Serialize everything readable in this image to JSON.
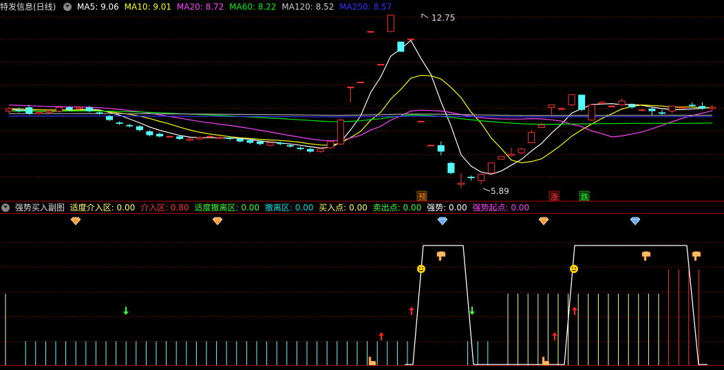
{
  "main_panel": {
    "title": "特发信息(日线)",
    "ma": [
      {
        "label": "MA5: 9.06",
        "color": "#ffffff"
      },
      {
        "label": "MA10: 9.01",
        "color": "#ffff00"
      },
      {
        "label": "MA20: 8.72",
        "color": "#ff44ff"
      },
      {
        "label": "MA60: 8.22",
        "color": "#00ee00"
      },
      {
        "label": "MA120: 8.52",
        "color": "#cccccc"
      },
      {
        "label": "MA250: 8.57",
        "color": "#3333ff"
      }
    ],
    "high_label": "12.75",
    "low_label": "5.89",
    "markers": [
      {
        "text": "预",
        "color": "#ff8800"
      },
      {
        "text": "涨",
        "color": "#ff3333"
      },
      {
        "text": "跌",
        "color": "#33ff33"
      }
    ]
  },
  "sub_panel": {
    "title": "强势买入副图",
    "indicators": [
      {
        "label": "适度介入区: 0.00",
        "color": "#ffff66"
      },
      {
        "label": "介入区: 0.80",
        "color": "#ff3333"
      },
      {
        "label": "适度撤离区: 0.00",
        "color": "#33ff33"
      },
      {
        "label": "撤离区: 0.00",
        "color": "#00dddd"
      },
      {
        "label": "买入点: 0.00",
        "color": "#ffff66"
      },
      {
        "label": "卖出点: 0.00",
        "color": "#33ff33"
      },
      {
        "label": "强势: 0.00",
        "color": "#ffffff"
      },
      {
        "label": "强势起点: 0.00",
        "color": "#ff44ff"
      }
    ]
  },
  "colors": {
    "up": "#ff3232",
    "down": "#54ffff",
    "grid": "#800000",
    "bg": "#000000"
  },
  "chart_data": {
    "type": "candlestick",
    "candles": [
      [
        8.95,
        9.05,
        8.85,
        9.1
      ],
      [
        9.0,
        8.95,
        8.9,
        9.1
      ],
      [
        9.1,
        8.85,
        8.8,
        9.2
      ],
      [
        8.85,
        8.9,
        8.8,
        8.95
      ],
      [
        8.9,
        8.95,
        8.85,
        9.0
      ],
      [
        8.95,
        9.1,
        8.9,
        9.15
      ],
      [
        9.1,
        9.0,
        8.95,
        9.15
      ],
      [
        9.05,
        9.1,
        9.0,
        9.15
      ],
      [
        9.1,
        8.95,
        8.9,
        9.15
      ],
      [
        8.9,
        8.85,
        8.8,
        8.95
      ],
      [
        8.75,
        8.6,
        8.55,
        8.8
      ],
      [
        8.5,
        8.45,
        8.4,
        8.55
      ],
      [
        8.4,
        8.35,
        8.3,
        8.45
      ],
      [
        8.35,
        8.2,
        8.15,
        8.4
      ],
      [
        8.15,
        8.0,
        7.95,
        8.2
      ],
      [
        8.05,
        7.95,
        7.9,
        8.1
      ],
      [
        7.95,
        7.95,
        7.9,
        8.0
      ],
      [
        7.95,
        7.85,
        7.8,
        8.0
      ],
      [
        7.8,
        7.85,
        7.75,
        7.9
      ],
      [
        7.85,
        7.9,
        7.8,
        7.95
      ],
      [
        7.95,
        7.95,
        7.9,
        8.0
      ],
      [
        7.9,
        7.9,
        7.85,
        7.95
      ],
      [
        7.9,
        7.85,
        7.8,
        7.95
      ],
      [
        7.85,
        7.75,
        7.7,
        7.9
      ],
      [
        7.8,
        7.7,
        7.65,
        7.85
      ],
      [
        7.75,
        7.65,
        7.6,
        7.8
      ],
      [
        7.6,
        7.7,
        7.55,
        7.75
      ],
      [
        7.7,
        7.65,
        7.6,
        7.75
      ],
      [
        7.6,
        7.55,
        7.5,
        7.65
      ],
      [
        7.5,
        7.45,
        7.4,
        7.55
      ],
      [
        7.45,
        7.35,
        7.3,
        7.5
      ],
      [
        7.35,
        7.45,
        7.3,
        7.5
      ],
      [
        7.5,
        7.75,
        7.45,
        7.8
      ],
      [
        7.65,
        8.6,
        7.6,
        8.65
      ],
      [
        9.9,
        9.9,
        9.3,
        9.9
      ],
      [
        10.1,
        10.1,
        10.1,
        10.1
      ],
      [
        12.1,
        12.1,
        12.1,
        12.1
      ],
      [
        10.8,
        10.8,
        10.8,
        10.8
      ],
      [
        12.1,
        12.75,
        12.1,
        12.75
      ],
      [
        11.7,
        11.3,
        11.7,
        11.3
      ],
      [
        11.8,
        11.8,
        11.8,
        11.8
      ],
      [
        8.55,
        8.55,
        8.55,
        8.55
      ],
      [
        7.6,
        7.6,
        7.6,
        7.6
      ],
      [
        7.6,
        7.35,
        7.2,
        7.75
      ],
      [
        6.9,
        6.5,
        6.45,
        6.95
      ],
      [
        6.05,
        6.1,
        5.89,
        6.5
      ],
      [
        6.35,
        6.3,
        6.2,
        6.4
      ],
      [
        6.2,
        6.45,
        6.05,
        6.5
      ],
      [
        6.5,
        6.9,
        6.45,
        6.9
      ],
      [
        7.05,
        7.15,
        7.05,
        7.15
      ],
      [
        7.2,
        7.25,
        7.15,
        7.5
      ],
      [
        7.3,
        7.45,
        7.25,
        7.5
      ],
      [
        7.7,
        8.1,
        7.7,
        8.2
      ],
      [
        8.3,
        8.4,
        8.3,
        8.5
      ],
      [
        9.1,
        9.2,
        8.8,
        9.2
      ],
      [
        9.05,
        9.05,
        9.0,
        9.1
      ],
      [
        9.2,
        9.6,
        9.15,
        9.6
      ],
      [
        9.6,
        9.0,
        8.95,
        9.6
      ],
      [
        8.6,
        9.2,
        8.55,
        9.25
      ],
      [
        9.25,
        9.3,
        9.2,
        9.35
      ],
      [
        9.15,
        9.15,
        9.1,
        9.2
      ],
      [
        9.2,
        9.35,
        9.15,
        9.45
      ],
      [
        9.2,
        9.1,
        9.05,
        9.25
      ],
      [
        9.0,
        9.0,
        8.95,
        9.05
      ],
      [
        9.05,
        8.95,
        8.8,
        9.1
      ],
      [
        8.9,
        8.85,
        8.8,
        9.0
      ],
      [
        8.95,
        9.15,
        8.85,
        9.15
      ],
      [
        9.1,
        9.1,
        9.05,
        9.15
      ],
      [
        9.2,
        9.15,
        9.1,
        9.3
      ],
      [
        9.15,
        9.05,
        9.0,
        9.3
      ],
      [
        9.05,
        9.1,
        9.0,
        9.2
      ]
    ]
  }
}
